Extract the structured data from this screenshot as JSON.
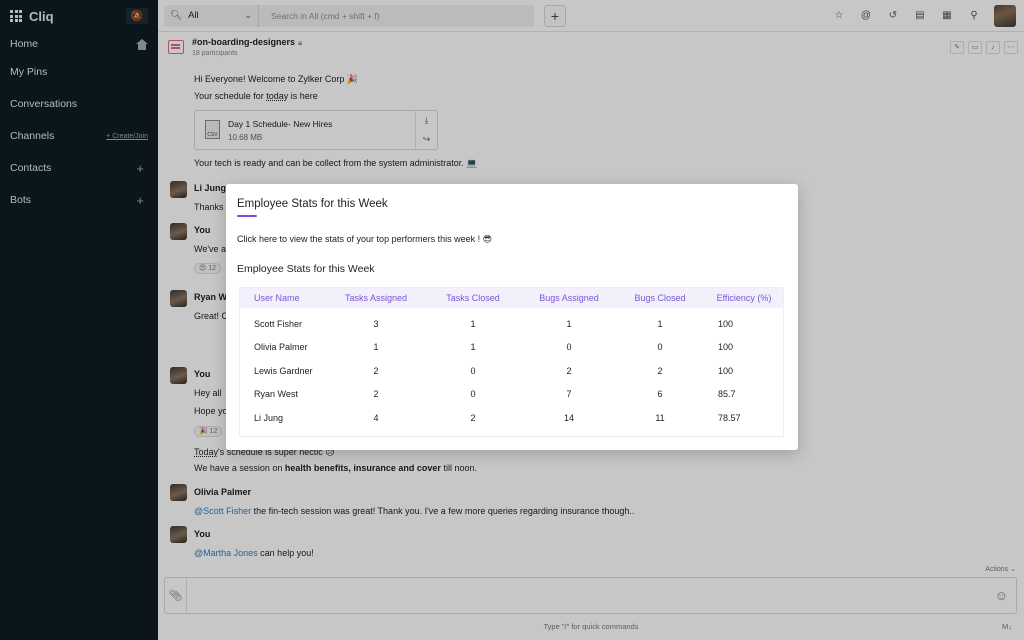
{
  "app": {
    "name": "Cliq"
  },
  "sidebar": {
    "items": [
      {
        "label": "Home"
      },
      {
        "label": "My Pins"
      },
      {
        "label": "Conversations"
      },
      {
        "label": "Channels",
        "action": "+ Create/Join"
      },
      {
        "label": "Contacts"
      },
      {
        "label": "Bots"
      }
    ]
  },
  "topbar": {
    "scope": "All",
    "search_placeholder": "Search in All (cmd + shift + f)"
  },
  "channel": {
    "name": "#on-boarding-designers",
    "participants": "18 participants"
  },
  "messages": {
    "m1_line1": "Hi Everyone! Welcome to Zylker Corp 🎉",
    "m1_line2_a": "Your schedule for ",
    "m1_line2_b": "today",
    "m1_line2_c": " is here",
    "file_name": "Day 1 Schedule- New Hires",
    "file_size": "10.68 MB",
    "file_type": "CSV",
    "m1_line3": "Your tech is ready and can be collect from the system administrator. 💻",
    "s2": "Li Jung",
    "s2_line": "Thanks",
    "s3": "You",
    "s3_line": "We've a",
    "s3_reaction": "😍 12",
    "s4": "Ryan W",
    "s4_line": "Great! C",
    "s5": "You",
    "s5_line1": "Hey all",
    "s5_line2": "Hope yo",
    "s5_reaction": "🎉 12",
    "s5_line3_a": "Today",
    "s5_line3_b": "'s schedule is super hectic 😥",
    "s5_line4_a": "We have a session on ",
    "s5_line4_b": "health benefits, insurance and cover",
    "s5_line4_c": " till noon.",
    "s6": "Olivia Palmer",
    "s6_mention": "@Scott Fisher",
    "s6_line": " the fin-tech session was great! Thank you. I've a few more queries regarding insurance though..",
    "s7": "You",
    "s7_mention": "@Martha Jones",
    "s7_line": " can help you!"
  },
  "composer": {
    "actions": "Actions",
    "hint": "Type \"/\" for quick commands",
    "md": "M↓"
  },
  "modal": {
    "title": "Employee Stats for this Week",
    "description": "Click here to view the stats of your top performers this week ! 😎",
    "table_title": "Employee Stats for this Week",
    "columns": [
      "User Name",
      "Tasks Assigned",
      "Tasks Closed",
      "Bugs Assigned",
      "Bugs Closed",
      "Efficiency (%)"
    ],
    "rows": [
      [
        "Scott Fisher",
        "3",
        "1",
        "1",
        "1",
        "100"
      ],
      [
        "Olivia Palmer",
        "1",
        "1",
        "0",
        "0",
        "100"
      ],
      [
        "Lewis Gardner",
        "2",
        "0",
        "2",
        "2",
        "100"
      ],
      [
        "Ryan West",
        "2",
        "0",
        "7",
        "6",
        "85.7"
      ],
      [
        "Li Jung",
        "4",
        "2",
        "14",
        "11",
        "78.57"
      ]
    ]
  },
  "colors": {
    "accent": "#7b4fd6",
    "sidebar": "#0d1b24",
    "mention": "#2b7fc4"
  }
}
